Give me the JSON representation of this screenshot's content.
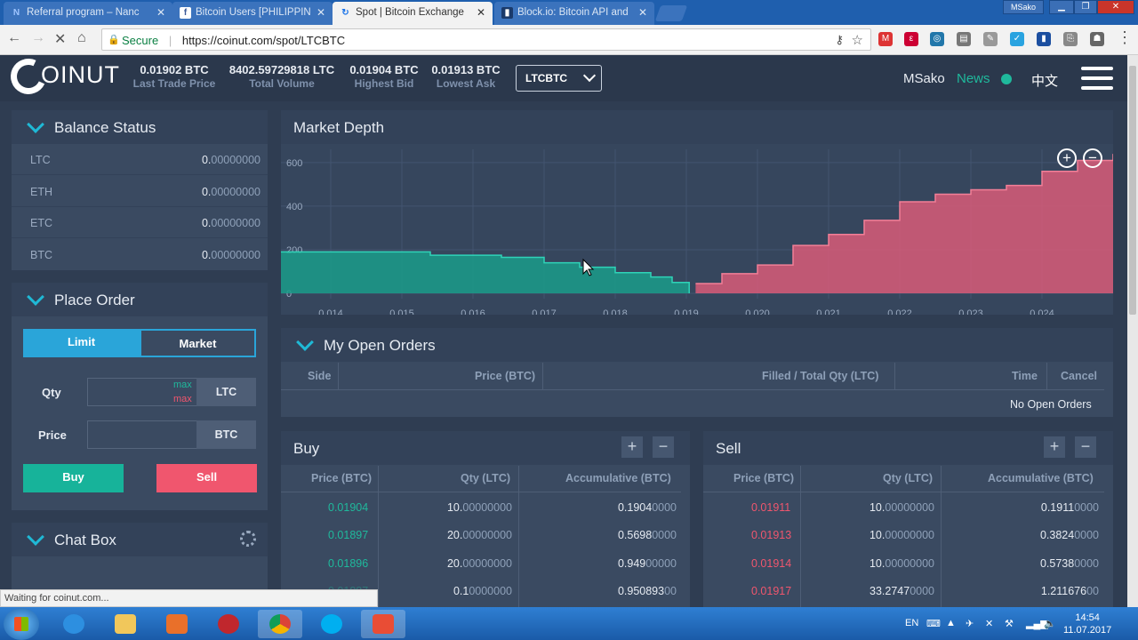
{
  "browser": {
    "tabs": [
      {
        "title": "Referral program – Nanc",
        "icon": "N"
      },
      {
        "title": "Bitcoin Users [PHILIPPIN",
        "icon": "f"
      },
      {
        "title": "Spot | Bitcoin Exchange",
        "icon": "↻"
      },
      {
        "title": "Block.io: Bitcoin API and",
        "icon": "▮"
      }
    ],
    "window_user": "MSako",
    "secure_label": "Secure",
    "url": "https://coinut.com/spot/LTCBTC",
    "status_text": "Waiting for coinut.com..."
  },
  "header": {
    "logo": "OINUT",
    "stats": [
      {
        "value": "0.01902 BTC",
        "label": "Last Trade Price"
      },
      {
        "value": "8402.59729818 LTC",
        "label": "Total Volume"
      },
      {
        "value": "0.01904 BTC",
        "label": "Highest Bid"
      },
      {
        "value": "0.01913 BTC",
        "label": "Lowest Ask"
      }
    ],
    "pair": "LTCBTC",
    "username": "MSako",
    "news": "News",
    "lang": "中文"
  },
  "balance": {
    "title": "Balance Status",
    "rows": [
      {
        "coin": "LTC",
        "int": "0.",
        "dec": "00000000"
      },
      {
        "coin": "ETH",
        "int": "0.",
        "dec": "00000000"
      },
      {
        "coin": "ETC",
        "int": "0.",
        "dec": "00000000"
      },
      {
        "coin": "BTC",
        "int": "0.",
        "dec": "00000000"
      }
    ]
  },
  "place_order": {
    "title": "Place Order",
    "tab_limit": "Limit",
    "tab_market": "Market",
    "qty_label": "Qty",
    "qty_unit": "LTC",
    "max_buy": "max",
    "max_sell": "max",
    "price_label": "Price",
    "price_unit": "BTC",
    "buy": "Buy",
    "sell": "Sell"
  },
  "chat": {
    "title": "Chat Box"
  },
  "depth": {
    "title": "Market Depth",
    "y_ticks": [
      "600",
      "400",
      "200",
      "0"
    ],
    "x_ticks": [
      "0.014",
      "0.015",
      "0.016",
      "0.017",
      "0.018",
      "0.019",
      "0.020",
      "0.021",
      "0.022",
      "0.023",
      "0.024"
    ],
    "zoom_in": "+",
    "zoom_out": "−"
  },
  "chart_data": {
    "type": "area",
    "title": "Market Depth",
    "xlim": [
      0.0133,
      0.025
    ],
    "ylim": [
      0,
      620
    ],
    "series": [
      {
        "color": "#1a9c8a",
        "x": [
          0.0133,
          0.015,
          0.0154,
          0.016,
          0.0164,
          0.017,
          0.0175,
          0.018,
          0.0185,
          0.0188,
          0.01904
        ],
        "y": [
          190,
          190,
          175,
          175,
          165,
          140,
          120,
          95,
          75,
          50,
          0
        ]
      },
      {
        "color": "#d85c78",
        "x": [
          0.01913,
          0.0195,
          0.02,
          0.0205,
          0.021,
          0.0215,
          0.022,
          0.0225,
          0.023,
          0.0235,
          0.024,
          0.0245,
          0.025
        ],
        "y": [
          45,
          90,
          130,
          220,
          270,
          335,
          420,
          455,
          475,
          495,
          560,
          610,
          640
        ]
      }
    ]
  },
  "open_orders": {
    "title": "My Open Orders",
    "columns": [
      "Side",
      "Price (BTC)",
      "Filled / Total Qty (LTC)",
      "Time",
      "Cancel"
    ],
    "empty": "No Open Orders"
  },
  "buy_book": {
    "title": "Buy",
    "plus": "+",
    "minus": "−",
    "columns": [
      "Price (BTC)",
      "Qty (LTC)",
      "Accumulative (BTC)"
    ],
    "rows": [
      {
        "price": "0.01904",
        "qty_a": "10.",
        "qty_b": "00000000",
        "acc_a": "0.1904",
        "acc_b": "0000"
      },
      {
        "price": "0.01897",
        "qty_a": "20.",
        "qty_b": "00000000",
        "acc_a": "0.5698",
        "acc_b": "0000"
      },
      {
        "price": "0.01896",
        "qty_a": "20.",
        "qty_b": "00000000",
        "acc_a": "0.949",
        "acc_b": "00000"
      },
      {
        "price": "0.01887",
        "qty_a": "0.1",
        "qty_b": "0000000",
        "acc_a": "0.950893",
        "acc_b": "00"
      }
    ]
  },
  "sell_book": {
    "title": "Sell",
    "plus": "+",
    "minus": "−",
    "columns": [
      "Price (BTC)",
      "Qty (LTC)",
      "Accumulative (BTC)"
    ],
    "rows": [
      {
        "price": "0.01911",
        "qty_a": "10.",
        "qty_b": "00000000",
        "acc_a": "0.1911",
        "acc_b": "0000"
      },
      {
        "price": "0.01913",
        "qty_a": "10.",
        "qty_b": "00000000",
        "acc_a": "0.3824",
        "acc_b": "0000"
      },
      {
        "price": "0.01914",
        "qty_a": "10.",
        "qty_b": "00000000",
        "acc_a": "0.5738",
        "acc_b": "0000"
      },
      {
        "price": "0.01917",
        "qty_a": "33.2747",
        "qty_b": "0000",
        "acc_a": "1.211676",
        "acc_b": "00"
      }
    ]
  },
  "taskbar": {
    "lang": "EN",
    "time": "14:54",
    "date": "11.07.2017"
  }
}
